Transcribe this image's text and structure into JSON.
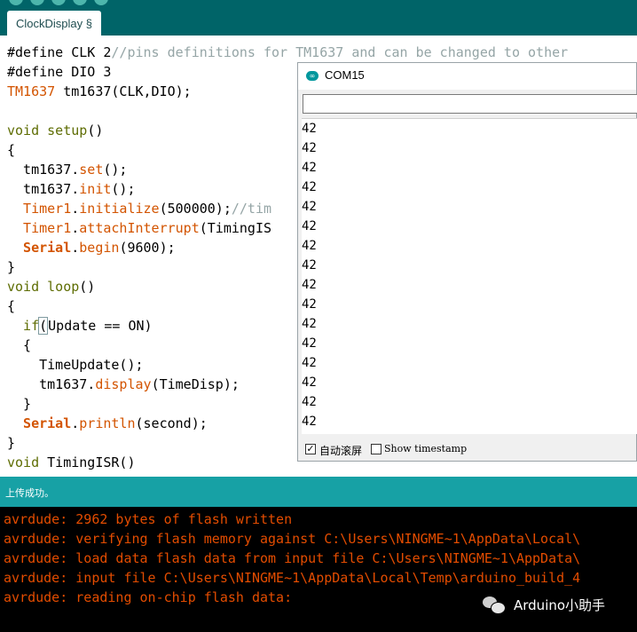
{
  "window": {
    "tab_label": "ClockDisplay §"
  },
  "colors": {
    "toolbar": "#006468",
    "status_bar": "#17a1a5",
    "console_text": "#e34c00",
    "keyword": "#5e6d03",
    "function": "#d35400",
    "comment": "#95a5a6"
  },
  "code": {
    "l1": {
      "a": "#define CLK 2",
      "b": "//pins definitions for TM1637 and can be changed to other"
    },
    "l2": {
      "a": "#define DIO 3"
    },
    "l3": {
      "type": "TM1637",
      "rest": " tm1637(CLK,DIO);"
    },
    "l5": {
      "kw": "void",
      "fn": " setup",
      "rest": "()"
    },
    "l6": "{",
    "l7": {
      "obj": "  tm1637.",
      "fn": "set",
      "rest": "();"
    },
    "l8": {
      "obj": "  tm1637.",
      "fn": "init",
      "rest": "();"
    },
    "l9": {
      "obj": "  Timer1",
      "dot": ".",
      "fn": "initialize",
      "rest": "(500000);",
      "cm": "//tim"
    },
    "l10": {
      "obj": "  Timer1",
      "dot": ".",
      "fn": "attachInterrupt",
      "rest": "(TimingIS"
    },
    "l11": {
      "obj": "  Serial",
      "dot": ".",
      "fn": "begin",
      "rest": "(9600);"
    },
    "l12": "}",
    "l13": {
      "kw": "void",
      "fn": " loop",
      "rest": "()"
    },
    "l14": "{",
    "l15": {
      "kw": "  if",
      "paren": "(",
      "rest": "Update == ON)"
    },
    "l16": "  {",
    "l17": {
      "rest": "    TimeUpdate();"
    },
    "l18": {
      "obj": "    tm1637.",
      "fn": "display",
      "rest": "(TimeDisp);"
    },
    "l19": "  }",
    "l20": {
      "obj": "  Serial",
      "dot": ".",
      "fn": "println",
      "rest": "(second);"
    },
    "l21": "}",
    "l22": {
      "kw": "void",
      "rest": " TimingISR()"
    }
  },
  "serial_monitor": {
    "title": "COM15",
    "output": [
      "42",
      "42",
      "42",
      "42",
      "42",
      "42",
      "42",
      "42",
      "42",
      "42",
      "42",
      "42",
      "42",
      "42",
      "42",
      "42"
    ],
    "autoscroll_label": "自动滚屏",
    "autoscroll_checked": "✓",
    "timestamp_label": "Show timestamp"
  },
  "status": {
    "message": "上传成功。"
  },
  "console": {
    "lines": [
      "avrdude: 2962 bytes of flash written",
      "avrdude: verifying flash memory against C:\\Users\\NINGME~1\\AppData\\Local\\",
      "avrdude: load data flash data from input file C:\\Users\\NINGME~1\\AppData\\",
      "avrdude: input file C:\\Users\\NINGME~1\\AppData\\Local\\Temp\\arduino_build_4",
      "avrdude: reading on-chip flash data:"
    ],
    "progress_partial": "  ......  ............................................"
  },
  "watermark": {
    "text": "Arduino小助手"
  }
}
